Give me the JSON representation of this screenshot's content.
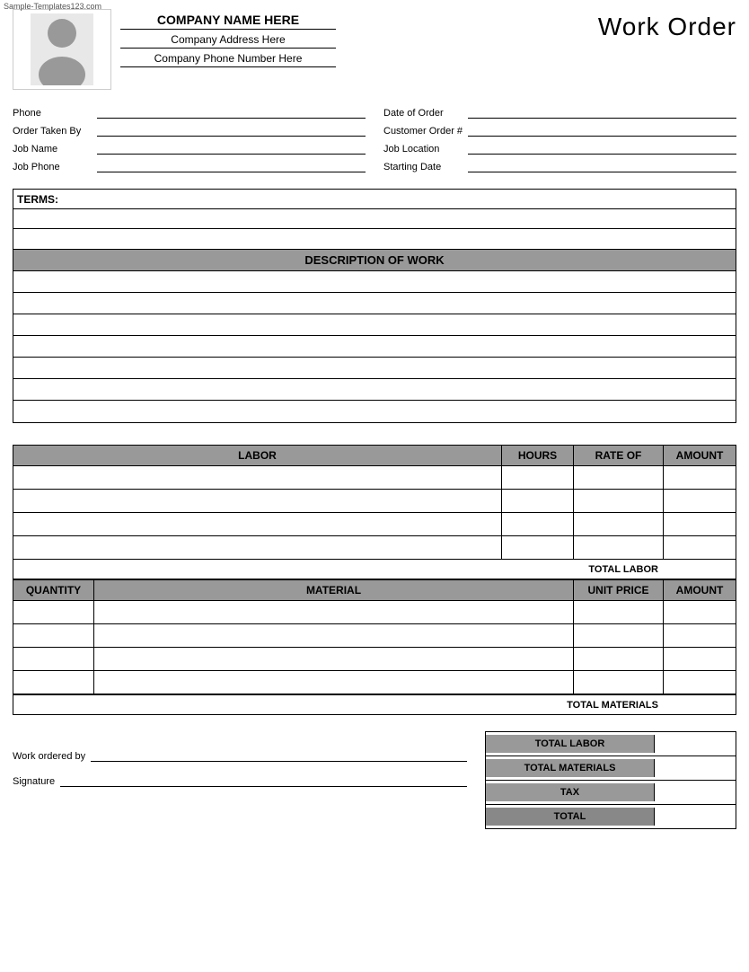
{
  "watermark": "Sample-Templates123.com",
  "header": {
    "company_name": "COMPANY NAME HERE",
    "company_address": "Company Address Here",
    "company_phone": "Company Phone Number Here",
    "title": "Work Order"
  },
  "form": {
    "left": [
      {
        "label": "Phone",
        "value": ""
      },
      {
        "label": "Order Taken By",
        "value": ""
      },
      {
        "label": "Job Name",
        "value": ""
      },
      {
        "label": "Job Phone",
        "value": ""
      }
    ],
    "right": [
      {
        "label": "Date of Order",
        "value": ""
      },
      {
        "label": "Customer Order #",
        "value": ""
      },
      {
        "label": "Job Location",
        "value": ""
      },
      {
        "label": "Starting Date",
        "value": ""
      }
    ]
  },
  "terms": {
    "label": "TERMS:",
    "rows": 2
  },
  "description": {
    "header": "DESCRIPTION OF WORK",
    "rows": 7
  },
  "labor": {
    "columns": [
      "LABOR",
      "HOURS",
      "RATE OF",
      "AMOUNT"
    ],
    "rows": 4,
    "total_label": "TOTAL LABOR"
  },
  "materials": {
    "columns": [
      "QUANTITY",
      "MATERIAL",
      "UNIT PRICE",
      "AMOUNT"
    ],
    "rows": 4,
    "total_label": "TOTAL MATERIALS"
  },
  "summary": {
    "work_ordered_label": "Work ordered by",
    "signature_label": "Signature",
    "totals": [
      {
        "label": "TOTAL LABOR"
      },
      {
        "label": "TOTAL MATERIALS"
      },
      {
        "label": "TAX"
      },
      {
        "label": "TOTAL"
      }
    ]
  }
}
